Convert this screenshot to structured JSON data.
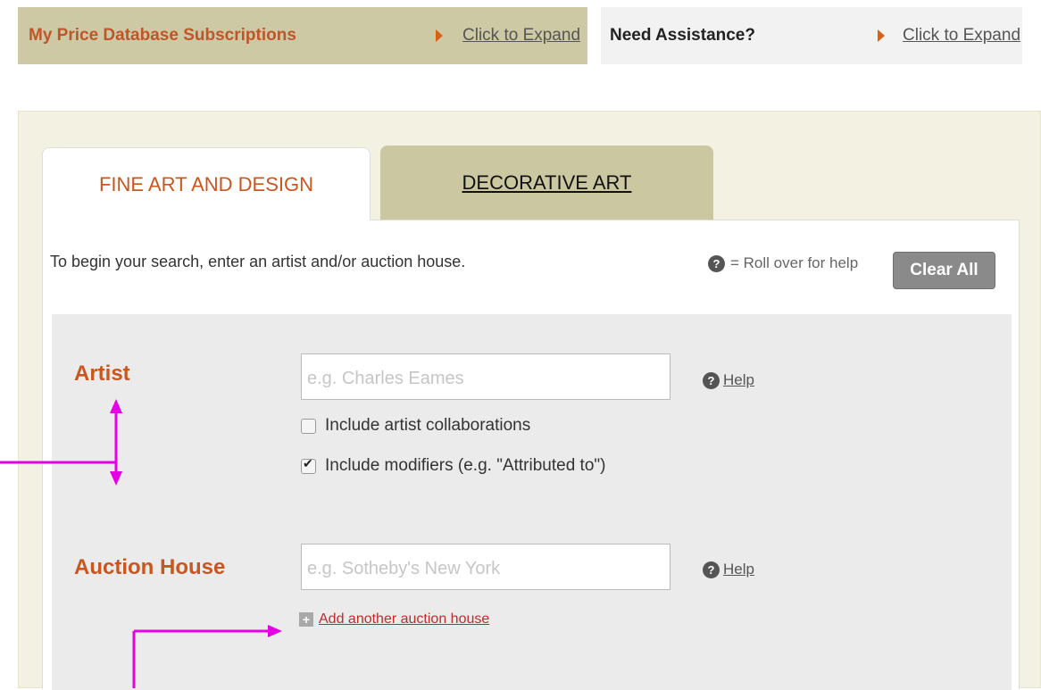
{
  "top_bars": {
    "subscriptions": {
      "title": "My Price Database Subscriptions",
      "expand": "Click to Expand"
    },
    "assistance": {
      "title": "Need Assistance?",
      "expand": "Click to Expand"
    }
  },
  "tabs": [
    {
      "label": "FINE ART AND DESIGN",
      "active": true
    },
    {
      "label": "DECORATIVE ART",
      "active": false
    }
  ],
  "search": {
    "intro": "To begin your search, enter an artist and/or auction house.",
    "help_legend_icon": "?",
    "help_legend": "= Roll over for help",
    "clear_all": "Clear All"
  },
  "artist": {
    "label": "Artist",
    "placeholder": "e.g. Charles Eames",
    "help": "Help",
    "checkboxes": [
      {
        "label": "Include artist collaborations",
        "checked": false
      },
      {
        "label": "Include modifiers (e.g. \"Attributed to\")",
        "checked": true
      }
    ]
  },
  "auction_house": {
    "label": "Auction House",
    "placeholder": "e.g. Sotheby's New York",
    "help": "Help",
    "add_another": "Add another auction house"
  },
  "colors": {
    "accent_orange": "#c9561f",
    "tab_olive": "#cbc7a0",
    "annotation_magenta": "#e600e6"
  },
  "icons": [
    "expand-arrow-icon",
    "help-question-icon",
    "plus-icon",
    "checkbox-icon"
  ]
}
